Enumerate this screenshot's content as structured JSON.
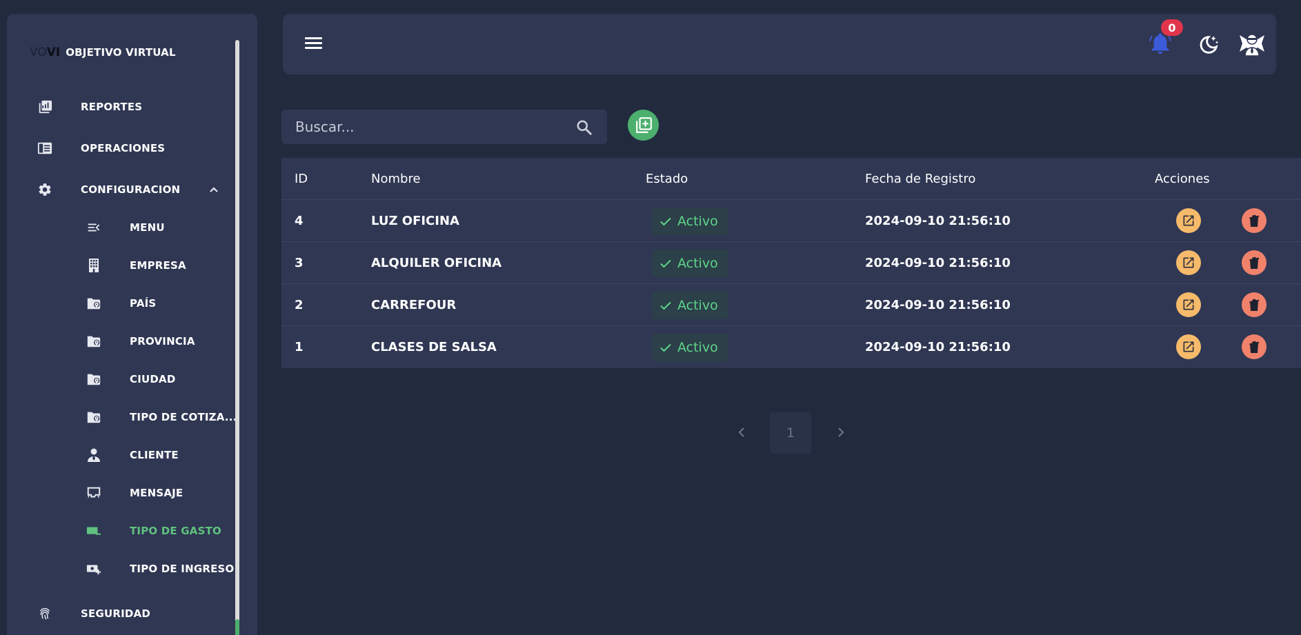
{
  "brand": {
    "mark_light": "VO",
    "mark_dark": "VI",
    "name": "OBJETIVO VIRTUAL"
  },
  "sidebar": {
    "items": [
      {
        "label": "REPORTES",
        "icon": "reports-icon"
      },
      {
        "label": "OPERACIONES",
        "icon": "operations-icon"
      },
      {
        "label": "CONFIGURACION",
        "icon": "gear-icon",
        "expanded": true
      },
      {
        "label": "MENU",
        "icon": "menu-open-icon"
      },
      {
        "label": "EMPRESA",
        "icon": "building-icon"
      },
      {
        "label": "PAÍS",
        "icon": "folder-location-icon"
      },
      {
        "label": "PROVINCIA",
        "icon": "folder-location-icon"
      },
      {
        "label": "CIUDAD",
        "icon": "folder-location-icon"
      },
      {
        "label": "TIPO DE COTIZA...",
        "icon": "folder-location-icon"
      },
      {
        "label": "CLIENTE",
        "icon": "person-icon"
      },
      {
        "label": "MENSAJE",
        "icon": "message-icon"
      },
      {
        "label": "TIPO DE GASTO",
        "icon": "money-minus-icon",
        "active": true
      },
      {
        "label": "TIPO DE INGRESO",
        "icon": "money-plus-icon"
      },
      {
        "label": "SEGURIDAD",
        "icon": "fingerprint-icon"
      }
    ]
  },
  "header": {
    "notifications_count": "0"
  },
  "search": {
    "placeholder": "Buscar..."
  },
  "table": {
    "columns": [
      "ID",
      "Nombre",
      "Estado",
      "Fecha de Registro",
      "Acciones"
    ],
    "rows": [
      {
        "id": "4",
        "nombre": "LUZ OFICINA",
        "estado": "Activo",
        "fecha": "2024-09-10 21:56:10"
      },
      {
        "id": "3",
        "nombre": "ALQUILER OFICINA",
        "estado": "Activo",
        "fecha": "2024-09-10 21:56:10"
      },
      {
        "id": "2",
        "nombre": "CARREFOUR",
        "estado": "Activo",
        "fecha": "2024-09-10 21:56:10"
      },
      {
        "id": "1",
        "nombre": "CLASES DE SALSA",
        "estado": "Activo",
        "fecha": "2024-09-10 21:56:10"
      }
    ]
  },
  "pagination": {
    "current_page": "1"
  },
  "colors": {
    "background": "#222a3e",
    "panel": "#2f3753",
    "accent_green": "#4caf6e",
    "active_text": "#5fc27e",
    "status_text": "#5fd48a",
    "edit": "#f6ba6b",
    "delete": "#f0826b",
    "badge": "#e0354b",
    "bell": "#3d5bd9"
  }
}
